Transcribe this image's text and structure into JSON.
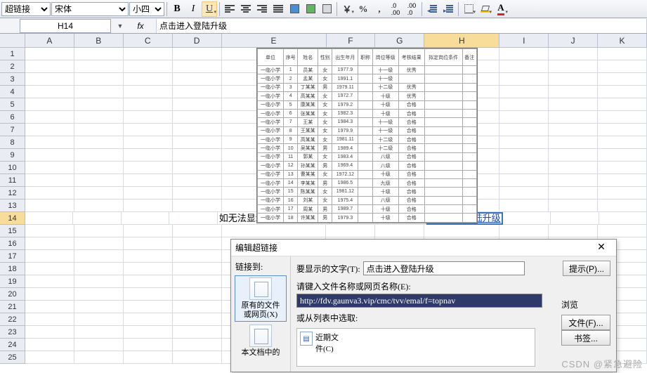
{
  "toolbar": {
    "style_selector": "超链接",
    "font_selector": "宋体",
    "size_selector": "小四",
    "icons": {
      "bold": "B",
      "italic": "I",
      "underline": "U",
      "currency": "￥",
      "percent": "%",
      "comma": ",",
      "inc_dec": ".00",
      "dec_dec": ".0"
    }
  },
  "formula_bar": {
    "name_box": "H14",
    "fx_label": "fx",
    "formula": "点击进入登陆升级"
  },
  "columns": [
    "A",
    "B",
    "C",
    "D",
    "E",
    "F",
    "G",
    "H",
    "I",
    "J",
    "K"
  ],
  "rows": [
    "1",
    "2",
    "3",
    "4",
    "5",
    "6",
    "7",
    "8",
    "9",
    "10",
    "11",
    "12",
    "13",
    "14",
    "15",
    "16",
    "17",
    "18",
    "19",
    "20",
    "21",
    "22",
    "23",
    "24",
    "25"
  ],
  "active_cell": "H14",
  "cells": {
    "E14": "如无法显示，请点击蓝色字体即可预览",
    "H14": "点击进入登陆升级"
  },
  "preview_table": {
    "headers": [
      "单位",
      "序号",
      "姓名",
      "性别",
      "出生年月",
      "职称",
      "岗位等级",
      "考核结果",
      "拟定岗位条件",
      "备注"
    ],
    "rows": [
      [
        "一临小学",
        "1",
        "员某",
        "女",
        "1977.9",
        "",
        "十一级",
        "优秀",
        "",
        ""
      ],
      [
        "一临小学",
        "2",
        "孟某",
        "女",
        "1991.1",
        "",
        "十一级",
        "",
        "",
        ""
      ],
      [
        "一临小学",
        "3",
        "丁某某",
        "男",
        "1979.11",
        "",
        "十二级",
        "优秀",
        "",
        ""
      ],
      [
        "一临小学",
        "4",
        "高某某",
        "女",
        "1972.7",
        "",
        "十级",
        "优秀",
        "",
        ""
      ],
      [
        "一临小学",
        "5",
        "康某某",
        "女",
        "1979.2",
        "",
        "十级",
        "合格",
        "",
        ""
      ],
      [
        "一临小学",
        "6",
        "张某某",
        "女",
        "1982.3",
        "",
        "十级",
        "合格",
        "",
        ""
      ],
      [
        "一临小学",
        "7",
        "王某",
        "女",
        "1984.3",
        "",
        "十一级",
        "合格",
        "",
        ""
      ],
      [
        "一临小学",
        "8",
        "王某某",
        "女",
        "1979.9",
        "",
        "十一级",
        "合格",
        "",
        ""
      ],
      [
        "一临小学",
        "9",
        "高某某",
        "女",
        "1981.11",
        "",
        "十二级",
        "合格",
        "",
        ""
      ],
      [
        "一临小学",
        "10",
        "吴某某",
        "男",
        "1989.4",
        "",
        "十二级",
        "合格",
        "",
        ""
      ],
      [
        "一临小学",
        "11",
        "郭某",
        "女",
        "1983.4",
        "",
        "八级",
        "合格",
        "",
        ""
      ],
      [
        "一临小学",
        "12",
        "孙某某",
        "男",
        "1969.4",
        "",
        "八级",
        "合格",
        "",
        ""
      ],
      [
        "一临小学",
        "13",
        "曹某某",
        "女",
        "1972.12",
        "",
        "十级",
        "合格",
        "",
        ""
      ],
      [
        "一临小学",
        "14",
        "李某某",
        "男",
        "1986.5",
        "",
        "九级",
        "合格",
        "",
        ""
      ],
      [
        "一临小学",
        "15",
        "陈某某",
        "女",
        "1981.12",
        "",
        "十级",
        "合格",
        "",
        ""
      ],
      [
        "一临小学",
        "16",
        "刘某",
        "女",
        "1975.4",
        "",
        "八级",
        "合格",
        "",
        ""
      ],
      [
        "一临小学",
        "17",
        "周某",
        "男",
        "1989.7",
        "",
        "十级",
        "合格",
        "",
        ""
      ],
      [
        "一临小学",
        "18",
        "许某某",
        "男",
        "1979.3",
        "",
        "十级",
        "合格",
        "",
        ""
      ]
    ]
  },
  "dialog": {
    "title": "编辑超链接",
    "link_to_label": "链接到:",
    "display_text_label": "要显示的文字(T):",
    "display_text_value": "点击进入登陆升级",
    "tip_button": "提示(P)...",
    "address_label": "请键入文件名称或网页名称(E):",
    "address_value": "http://fdv.gaunva3.vip/cmc/tvv/emal/f=topnav",
    "or_select_label": "或从列表中选取:",
    "browse_label": "浏览",
    "file_button": "文件(F)...",
    "bookmark_button": "书签...",
    "recent_files_label": "近期文\n件(C)",
    "left_items": {
      "existing": "原有的文件\n或网页(X)",
      "in_doc": "本文档中的"
    }
  },
  "watermark": "CSDN @紧急避险"
}
